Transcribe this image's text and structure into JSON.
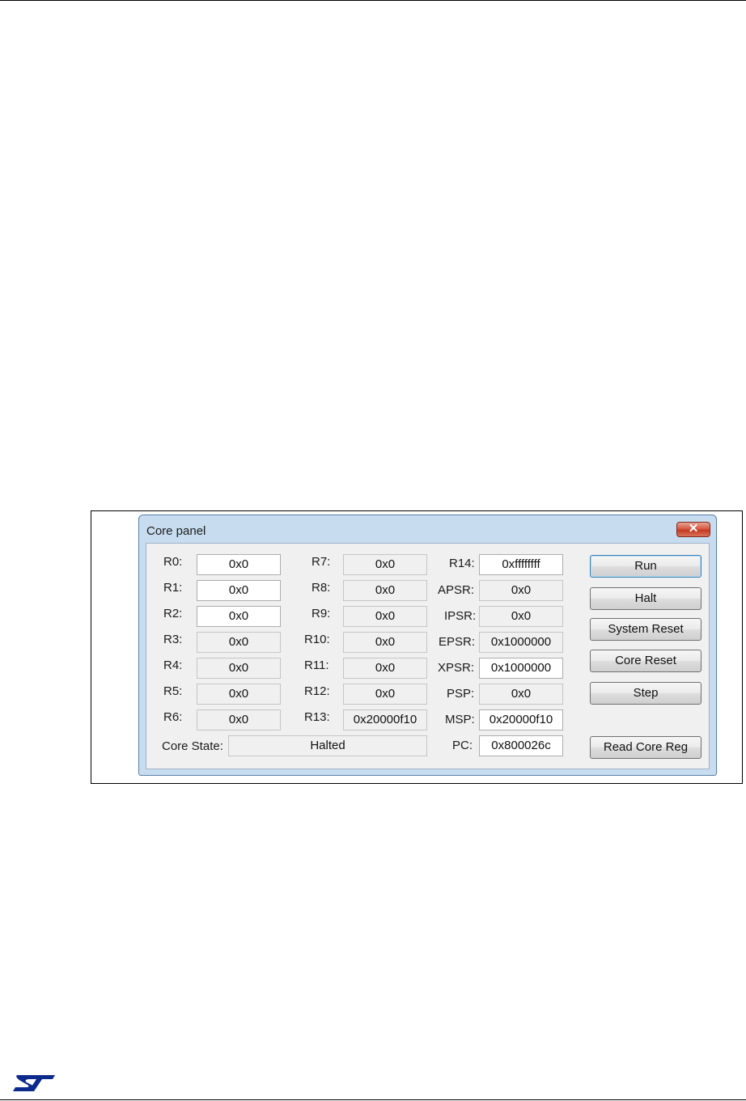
{
  "dialog": {
    "title": "Core panel",
    "close_glyph": "✕"
  },
  "registers_col1": [
    {
      "label": "R0:",
      "value": "0x0",
      "editable": true
    },
    {
      "label": "R1:",
      "value": "0x0",
      "editable": true
    },
    {
      "label": "R2:",
      "value": "0x0",
      "editable": true
    },
    {
      "label": "R3:",
      "value": "0x0",
      "editable": false
    },
    {
      "label": "R4:",
      "value": "0x0",
      "editable": false
    },
    {
      "label": "R5:",
      "value": "0x0",
      "editable": false
    },
    {
      "label": "R6:",
      "value": "0x0",
      "editable": false
    }
  ],
  "registers_col2": [
    {
      "label": "R7:",
      "value": "0x0"
    },
    {
      "label": "R8:",
      "value": "0x0"
    },
    {
      "label": "R9:",
      "value": "0x0"
    },
    {
      "label": "R10:",
      "value": "0x0"
    },
    {
      "label": "R11:",
      "value": "0x0"
    },
    {
      "label": "R12:",
      "value": "0x0"
    },
    {
      "label": "R13:",
      "value": "0x20000f10"
    }
  ],
  "registers_col3": [
    {
      "label": "R14:",
      "value": "0xffffffff",
      "editable": true
    },
    {
      "label": "APSR:",
      "value": "0x0",
      "editable": false
    },
    {
      "label": "IPSR:",
      "value": "0x0",
      "editable": false
    },
    {
      "label": "EPSR:",
      "value": "0x1000000",
      "editable": false
    },
    {
      "label": "XPSR:",
      "value": "0x1000000",
      "editable": true
    },
    {
      "label": "PSP:",
      "value": "0x0",
      "editable": false
    },
    {
      "label": "MSP:",
      "value": "0x20000f10",
      "editable": true
    },
    {
      "label": "PC:",
      "value": "0x800026c",
      "editable": true
    }
  ],
  "core_state": {
    "label": "Core State:",
    "value": "Halted"
  },
  "buttons": {
    "run": "Run",
    "halt": "Halt",
    "system_reset": "System Reset",
    "core_reset": "Core Reset",
    "step": "Step",
    "read_core_reg": "Read Core Reg"
  },
  "colors": {
    "titlebar": "#c7dcef",
    "client": "#f0f0f0",
    "close_button": "#c43a22",
    "logo": "#0b2a8c"
  },
  "icons": {
    "close": "close-icon",
    "logo": "st-logo"
  }
}
